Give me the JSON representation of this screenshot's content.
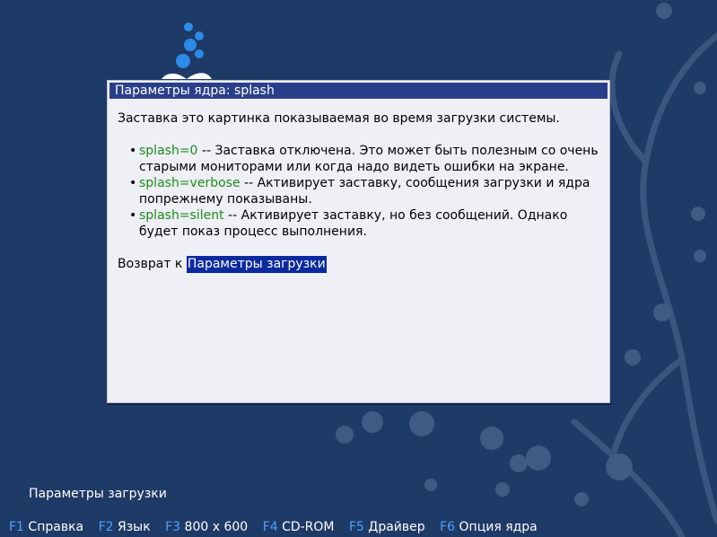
{
  "dialog": {
    "title": "Параметры ядра: splash",
    "intro": "Заставка это картинка показываемая во время загрузки системы.",
    "options": [
      {
        "key": "splash=0",
        "text": " -- Заставка отключена. Это может быть полезным со очень старыми мониторами или когда надо видеть ошибки на экране."
      },
      {
        "key": "splash=verbose",
        "text": " -- Активирует заставку, сообщения загрузки и ядра попрежнему показываны."
      },
      {
        "key": "splash=silent",
        "text": " -- Активирует заставку, но без сообщений. Однако будет показ процесс выполнения."
      }
    ],
    "back_prefix": "Возврат к ",
    "back_link": "Параметры загрузки"
  },
  "boot_options_label": "Параметры загрузки",
  "fkeys": [
    {
      "key": "F1",
      "label": "Справка"
    },
    {
      "key": "F2",
      "label": "Язык"
    },
    {
      "key": "F3",
      "label": "800 x 600"
    },
    {
      "key": "F4",
      "label": "CD-ROM"
    },
    {
      "key": "F5",
      "label": "Драйвер"
    },
    {
      "key": "F6",
      "label": "Опция ядра"
    }
  ],
  "colors": {
    "background": "#1e3a66",
    "title_bar": "#2a3f8a",
    "option_key": "#1d8a1d",
    "link_highlight": "#0b2a9e",
    "fkey": "#4aa3ff"
  }
}
